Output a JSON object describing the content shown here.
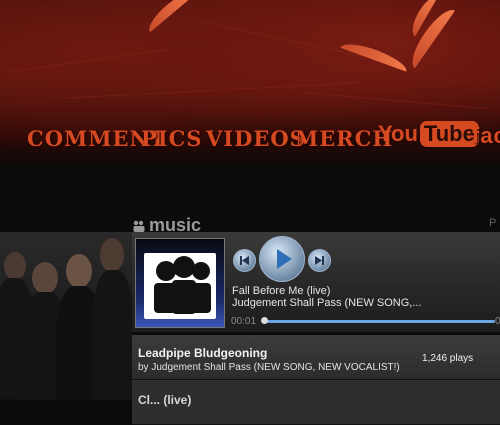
{
  "nav": {
    "comment": "COMMENT",
    "pics": "PICS",
    "videos": "VIDEOS",
    "merch": "MERCH",
    "youtube_you": "You",
    "youtube_tube": "Tube",
    "facebook": "fac"
  },
  "widget": {
    "logo": "music",
    "page_letter": "P"
  },
  "player": {
    "track_title": "Fall Before Me (live)",
    "track_sub": "Judgement Shall Pass (NEW SONG,...",
    "time_current": "00:01",
    "time_end": "0"
  },
  "playlist": [
    {
      "title": "Leadpipe Bludgeoning",
      "by": "by Judgement Shall Pass (NEW SONG, NEW VOCALIST!)",
      "plays": "1,246 plays"
    },
    {
      "title": "Cl... (live)"
    }
  ],
  "colors": {
    "nav_accent": "#d64a22",
    "progress": "#6aa6e0"
  }
}
